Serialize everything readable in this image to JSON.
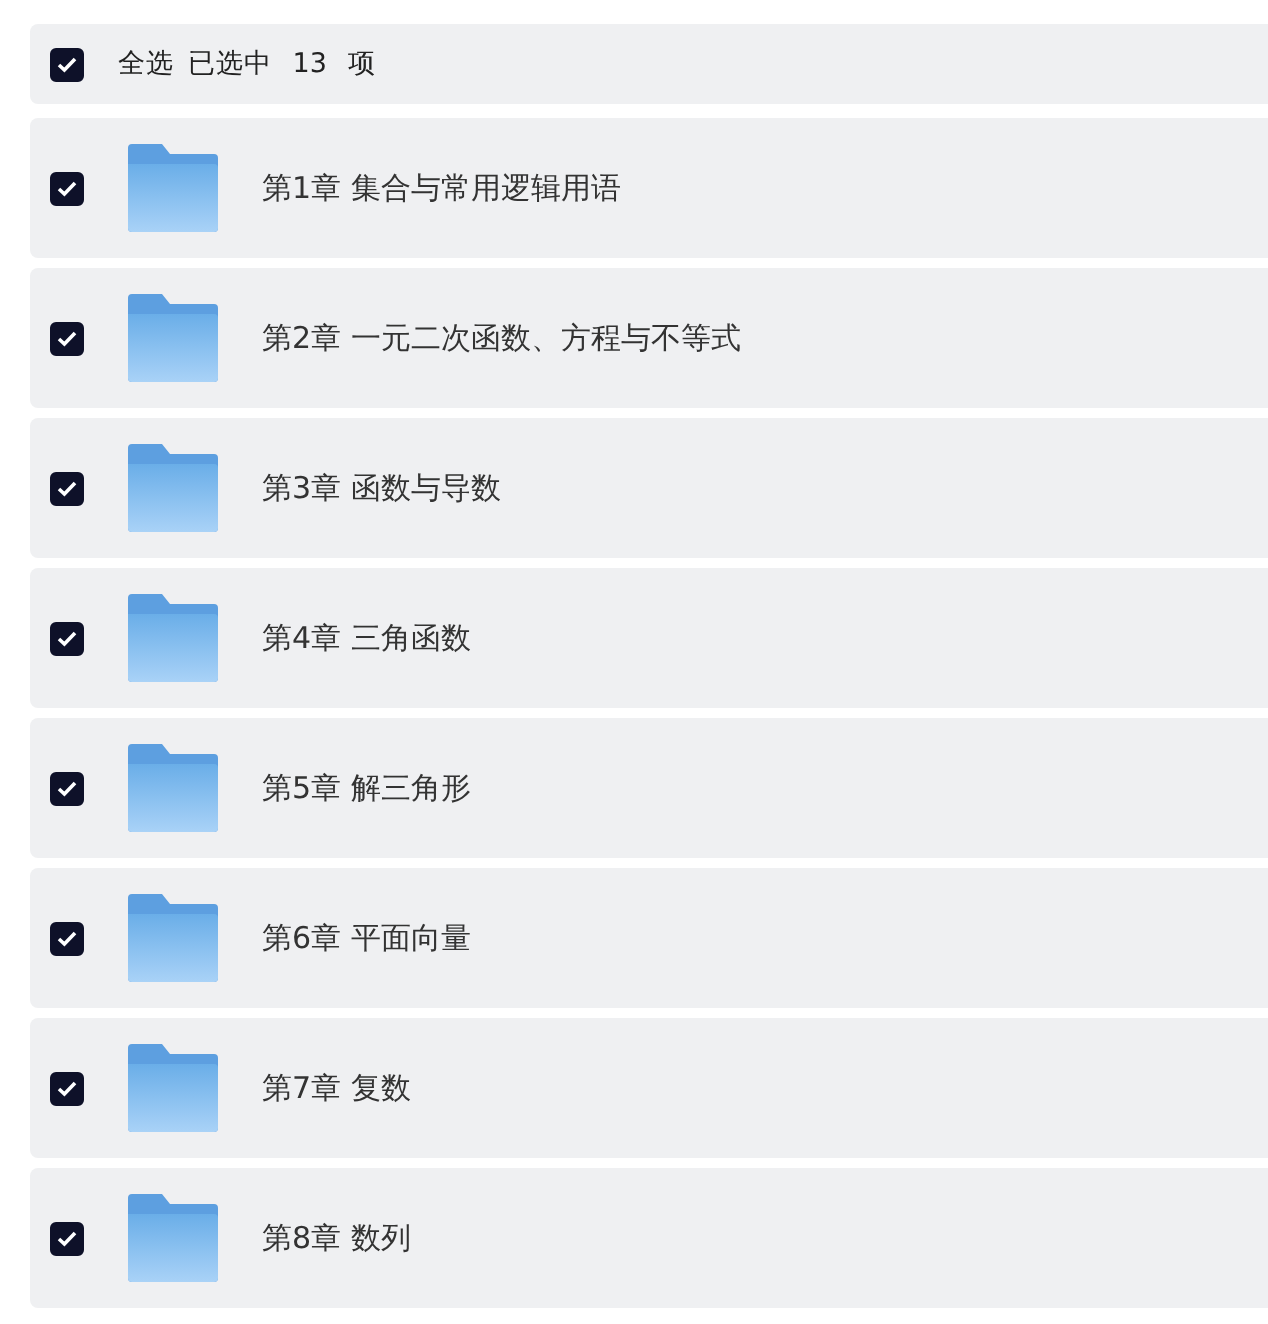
{
  "header": {
    "checked": true,
    "label": "全选",
    "count": "已选中 13 项"
  },
  "items": [
    {
      "name": "第1章 集合与常用逻辑用语",
      "checked": true
    },
    {
      "name": "第2章 一元二次函数、方程与不等式",
      "checked": true
    },
    {
      "name": "第3章 函数与导数",
      "checked": true
    },
    {
      "name": "第4章 三角函数",
      "checked": true
    },
    {
      "name": "第5章 解三角形",
      "checked": true
    },
    {
      "name": "第6章 平面向量",
      "checked": true
    },
    {
      "name": "第7章 复数",
      "checked": true
    },
    {
      "name": "第8章 数列",
      "checked": true
    }
  ]
}
